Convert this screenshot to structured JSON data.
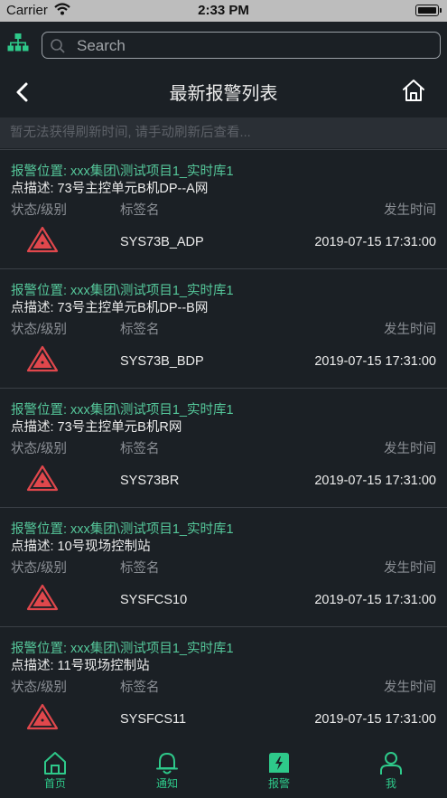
{
  "statusbar": {
    "carrier": "Carrier",
    "time": "2:33 PM"
  },
  "search": {
    "placeholder": "Search"
  },
  "nav": {
    "title": "最新报警列表"
  },
  "notice": "暂无法获得刷新时间, 请手动刷新后查看...",
  "headers": {
    "status": "状态/级别",
    "tag": "标签名",
    "time": "发生时间"
  },
  "alarms": [
    {
      "location": "报警位置: xxx集团\\测试项目1_实时库1",
      "description": "点描述: 73号主控单元B机DP--A网",
      "tag": "SYS73B_ADP",
      "time": "2019-07-15 17:31:00"
    },
    {
      "location": "报警位置: xxx集团\\测试项目1_实时库1",
      "description": "点描述: 73号主控单元B机DP--B网",
      "tag": "SYS73B_BDP",
      "time": "2019-07-15 17:31:00"
    },
    {
      "location": "报警位置: xxx集团\\测试项目1_实时库1",
      "description": "点描述: 73号主控单元B机R网",
      "tag": "SYS73BR",
      "time": "2019-07-15 17:31:00"
    },
    {
      "location": "报警位置: xxx集团\\测试项目1_实时库1",
      "description": "点描述: 10号现场控制站",
      "tag": "SYSFCS10",
      "time": "2019-07-15 17:31:00"
    },
    {
      "location": "报警位置: xxx集团\\测试项目1_实时库1",
      "description": "点描述: 11号现场控制站",
      "tag": "SYSFCS11",
      "time": "2019-07-15 17:31:00"
    }
  ],
  "tabs": {
    "home": "首页",
    "notify": "通知",
    "alarm": "报警",
    "me": "我"
  },
  "colors": {
    "accent": "#2ec98a",
    "warning": "#e0474c",
    "background": "#1b2025"
  }
}
